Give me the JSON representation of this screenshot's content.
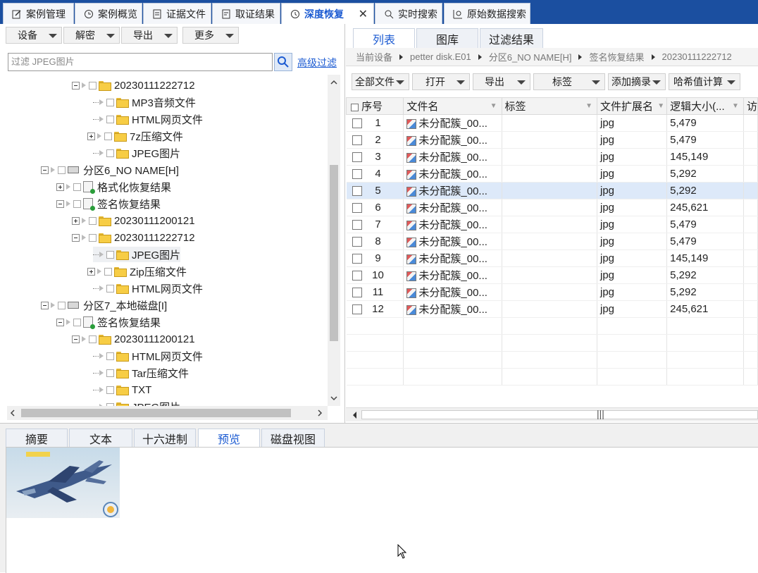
{
  "tabs": [
    {
      "label": "案例管理"
    },
    {
      "label": "案例概览"
    },
    {
      "label": "证据文件"
    },
    {
      "label": "取证结果"
    },
    {
      "label": "深度恢复"
    },
    {
      "label": "实时搜索"
    },
    {
      "label": "原始数据搜索"
    }
  ],
  "active_tab": "深度恢复",
  "left_toolbar": {
    "device": "设备",
    "decrypt": "解密",
    "export": "导出",
    "more": "更多"
  },
  "filter": {
    "placeholder": "过滤 JPEG图片",
    "advanced": "高级过滤"
  },
  "tree": {
    "n1": "20230111222712",
    "n2": "MP3音频文件",
    "n3": "HTML网页文件",
    "n4": "7z压缩文件",
    "n5": "JPEG图片",
    "n6": "分区6_NO NAME[H]",
    "n7": "格式化恢复结果",
    "n8": "签名恢复结果",
    "n9": "20230111200121",
    "n10": "20230111222712",
    "n11": "JPEG图片",
    "n12": "Zip压缩文件",
    "n13": "HTML网页文件",
    "n14": "分区7_本地磁盘[I]",
    "n15": "签名恢复结果",
    "n16": "20230111200121",
    "n17": "HTML网页文件",
    "n18": "Tar压缩文件",
    "n19": "TXT",
    "n20": "JPEG图片"
  },
  "right_tabs": {
    "list": "列表",
    "gallery": "图库",
    "filter_result": "过滤结果"
  },
  "breadcrumb": {
    "c0": "当前设备",
    "c1": "petter disk.E01",
    "c2": "分区6_NO NAME[H]",
    "c3": "签名恢复结果",
    "c4": "20230111222712"
  },
  "right_toolbar": {
    "all_files": "全部文件",
    "open": "打开",
    "export": "导出",
    "tag": "标签",
    "add_digest": "添加摘录",
    "hash": "哈希值计算"
  },
  "columns": {
    "index": "序号",
    "filename": "文件名",
    "tag": "标签",
    "ext": "文件扩展名",
    "size": "逻辑大小(...",
    "more": "访"
  },
  "rows": [
    {
      "index": "1",
      "name": "未分配簇_00...",
      "ext": "jpg",
      "size": "5,479"
    },
    {
      "index": "2",
      "name": "未分配簇_00...",
      "ext": "jpg",
      "size": "5,479"
    },
    {
      "index": "3",
      "name": "未分配簇_00...",
      "ext": "jpg",
      "size": "145,149"
    },
    {
      "index": "4",
      "name": "未分配簇_00...",
      "ext": "jpg",
      "size": "5,292"
    },
    {
      "index": "5",
      "name": "未分配簇_00...",
      "ext": "jpg",
      "size": "5,292"
    },
    {
      "index": "6",
      "name": "未分配簇_00...",
      "ext": "jpg",
      "size": "245,621"
    },
    {
      "index": "7",
      "name": "未分配簇_00...",
      "ext": "jpg",
      "size": "5,479"
    },
    {
      "index": "8",
      "name": "未分配簇_00...",
      "ext": "jpg",
      "size": "5,479"
    },
    {
      "index": "9",
      "name": "未分配簇_00...",
      "ext": "jpg",
      "size": "145,149"
    },
    {
      "index": "10",
      "name": "未分配簇_00...",
      "ext": "jpg",
      "size": "5,292"
    },
    {
      "index": "11",
      "name": "未分配簇_00...",
      "ext": "jpg",
      "size": "5,292"
    },
    {
      "index": "12",
      "name": "未分配簇_00...",
      "ext": "jpg",
      "size": "245,621"
    }
  ],
  "selected_row": "5",
  "bottom_tabs": {
    "summary": "摘要",
    "text": "文本",
    "hex": "十六进制",
    "preview": "预览",
    "disk": "磁盘视图"
  },
  "colors": {
    "topbar": "#1b4fa0",
    "accent": "#1c5bd2",
    "selected_row": "#dde9f9"
  }
}
